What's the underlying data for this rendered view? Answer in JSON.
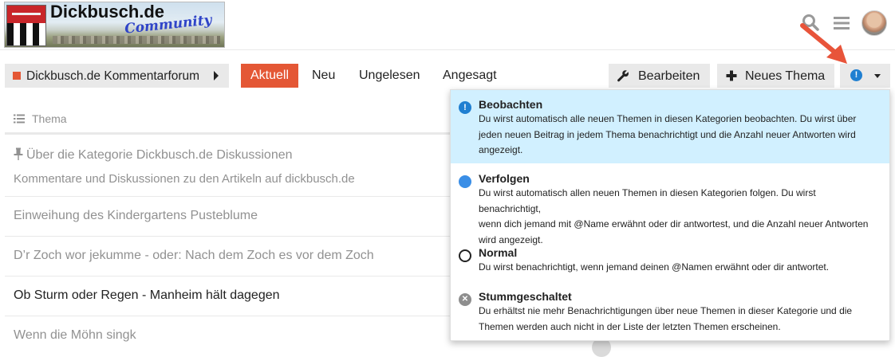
{
  "header": {
    "logo_title": "Dickbusch.de",
    "logo_subtitle": "Community"
  },
  "nav": {
    "category": "Dickbusch.de Kommentarforum",
    "tabs": [
      {
        "label": "Aktuell",
        "active": true
      },
      {
        "label": "Neu",
        "active": false
      },
      {
        "label": "Ungelesen",
        "active": false
      },
      {
        "label": "Angesagt",
        "active": false
      }
    ],
    "edit_button": "Bearbeiten",
    "new_topic_button": "Neues Thema",
    "notification_glyph": "!"
  },
  "topic_list": {
    "column_header": "Thema",
    "topics": [
      {
        "title": "Über die Kategorie Dickbusch.de Diskussionen",
        "description": "Kommentare und Diskussionen zu den Artikeln auf dickbusch.de",
        "pinned": true
      },
      {
        "title": "Einweihung des Kindergartens Pusteblume",
        "unread": false
      },
      {
        "title": "D’r Zoch wor jekumme - oder: Nach dem Zoch es vor dem Zoch",
        "unread": false
      },
      {
        "title": "Ob Sturm oder Regen - Manheim hält dagegen",
        "unread": true
      },
      {
        "title": "Wenn die Möhn singk",
        "unread": false
      }
    ]
  },
  "notification_menu": {
    "items": [
      {
        "name": "Beobachten",
        "icon": "exclamation-circle-icon",
        "selected": true,
        "lines": [
          "Du wirst automatisch alle neuen Themen in diesen Kategorien beobachten. Du wirst über",
          "jeden neuen Beitrag in jedem Thema benachrichtigt und die Anzahl neuer Antworten wird",
          "angezeigt."
        ]
      },
      {
        "name": "Verfolgen",
        "icon": "filled-circle-icon",
        "selected": false,
        "lines": [
          "Du wirst automatisch allen neuen Themen in diesen Kategorien folgen. Du wirst benachrichtigt,",
          "wenn dich jemand mit @Name erwähnt oder dir antwortest, und die Anzahl neuer Antworten",
          "wird angezeigt."
        ]
      },
      {
        "name": "Normal",
        "icon": "empty-circle-icon",
        "selected": false,
        "lines": [
          "Du wirst benachrichtigt, wenn jemand deinen @Namen erwähnt oder dir antwortet."
        ]
      },
      {
        "name": "Stummgeschaltet",
        "icon": "times-circle-icon",
        "selected": false,
        "lines": [
          "Du erhältst nie mehr Benachrichtigungen über neue Themen in dieser Kategorie und die",
          "Themen werden auch nicht in der Liste der letzten Themen erscheinen."
        ]
      }
    ]
  },
  "colors": {
    "accent": "#e45735",
    "selected_bg": "#d1f0ff",
    "notification_blue": "#1f7fd1",
    "annotation_arrow": "#e8543a"
  }
}
